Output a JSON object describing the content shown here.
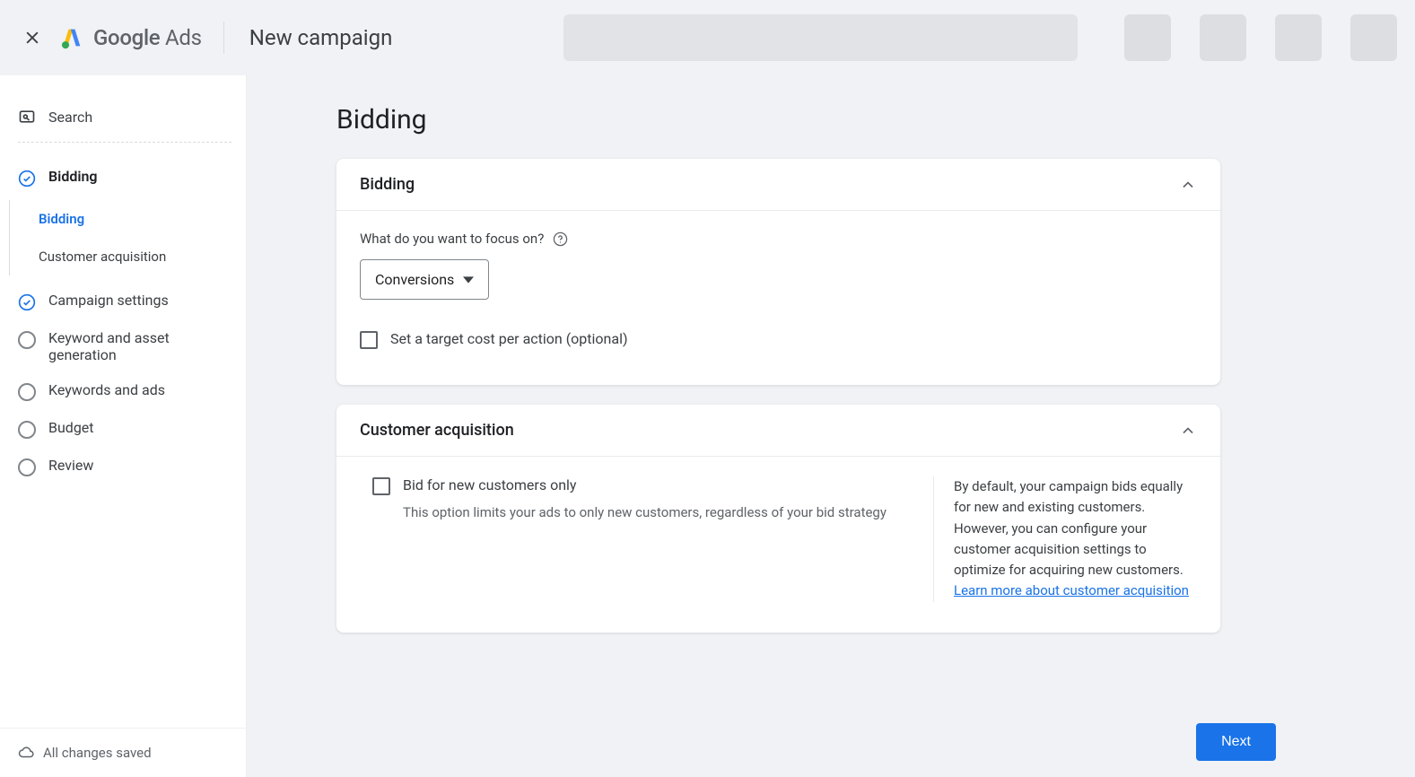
{
  "header": {
    "product_name_1": "Google",
    "product_name_2": " Ads",
    "page_title": "New campaign"
  },
  "sidebar": {
    "top_label": "Search",
    "steps": [
      {
        "label": "Bidding"
      },
      {
        "label": "Campaign settings"
      },
      {
        "label": "Keyword and asset generation"
      },
      {
        "label": "Keywords and ads"
      },
      {
        "label": "Budget"
      },
      {
        "label": "Review"
      }
    ],
    "substeps": [
      {
        "label": "Bidding"
      },
      {
        "label": "Customer acquisition"
      }
    ],
    "footer_status": "All changes saved"
  },
  "main": {
    "heading": "Bidding",
    "bidding_card": {
      "title": "Bidding",
      "focus_label": "What do you want to focus on?",
      "focus_value": "Conversions",
      "target_cpa_label": "Set a target cost per action (optional)"
    },
    "acquisition_card": {
      "title": "Customer acquisition",
      "checkbox_label": "Bid for new customers only",
      "checkbox_hint": "This option limits your ads to only new customers, regardless of your bid strategy",
      "info_text": "By default, your campaign bids equally for new and existing customers. However, you can configure your customer acquisition settings to optimize for acquiring new customers. ",
      "info_link": "Learn more about customer acquisition"
    },
    "next_button": "Next"
  }
}
